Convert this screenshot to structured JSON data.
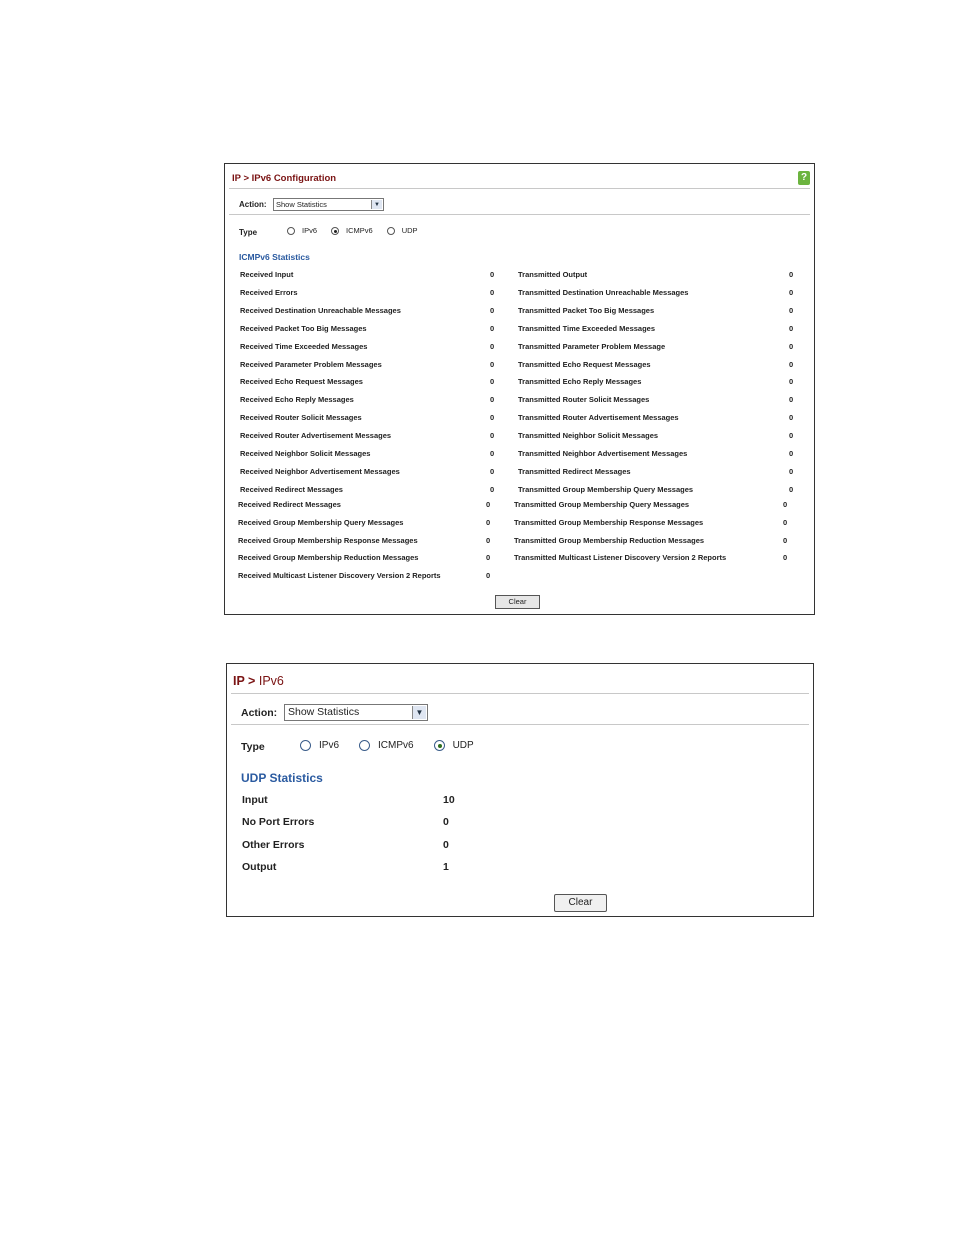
{
  "panel_icmp": {
    "title": "IP > IPv6 Configuration",
    "help_icon": "question-mark-icon",
    "action_label": "Action:",
    "action_value": "Show Statistics",
    "type_label": "Type",
    "radios": [
      {
        "label": "IPv6",
        "checked": false
      },
      {
        "label": "ICMPv6",
        "checked": true
      },
      {
        "label": "UDP",
        "checked": false
      }
    ],
    "section_title": "ICMPv6 Statistics",
    "left_stats": [
      {
        "label": "Received Input",
        "value": "0"
      },
      {
        "label": "Received Errors",
        "value": "0"
      },
      {
        "label": "Received Destination Unreachable Messages",
        "value": "0"
      },
      {
        "label": "Received Packet Too Big Messages",
        "value": "0"
      },
      {
        "label": "Received Time Exceeded Messages",
        "value": "0"
      },
      {
        "label": "Received Parameter Problem Messages",
        "value": "0"
      },
      {
        "label": "Received Echo Request Messages",
        "value": "0"
      },
      {
        "label": "Received Echo Reply Messages",
        "value": "0"
      },
      {
        "label": "Received Router Solicit Messages",
        "value": "0"
      },
      {
        "label": "Received Router Advertisement Messages",
        "value": "0"
      },
      {
        "label": "Received Neighbor Solicit Messages",
        "value": "0"
      },
      {
        "label": "Received Neighbor Advertisement Messages",
        "value": "0"
      },
      {
        "label": "Received Redirect Messages",
        "value": "0"
      }
    ],
    "right_stats": [
      {
        "label": "Transmitted Output",
        "value": "0"
      },
      {
        "label": "Transmitted Destination Unreachable Messages",
        "value": "0"
      },
      {
        "label": "Transmitted Packet Too Big Messages",
        "value": "0"
      },
      {
        "label": "Transmitted Time Exceeded Messages",
        "value": "0"
      },
      {
        "label": "Transmitted Parameter Problem Message",
        "value": "0"
      },
      {
        "label": "Transmitted Echo Request Messages",
        "value": "0"
      },
      {
        "label": "Transmitted Echo Reply Messages",
        "value": "0"
      },
      {
        "label": "Transmitted Router Solicit Messages",
        "value": "0"
      },
      {
        "label": "Transmitted Router Advertisement Messages",
        "value": "0"
      },
      {
        "label": "Transmitted Neighbor Solicit Messages",
        "value": "0"
      },
      {
        "label": "Transmitted Neighbor Advertisement Messages",
        "value": "0"
      },
      {
        "label": "Transmitted Redirect Messages",
        "value": "0"
      },
      {
        "label": "Transmitted Group Membership Query Messages",
        "value": "0"
      }
    ],
    "left_stats_ext": [
      {
        "label": "Received Redirect Messages",
        "value": "0"
      },
      {
        "label": "Received Group Membership Query Messages",
        "value": "0"
      },
      {
        "label": "Received Group Membership Response Messages",
        "value": "0"
      },
      {
        "label": "Received Group Membership Reduction Messages",
        "value": "0"
      },
      {
        "label": "Received Multicast Listener Discovery Version 2 Reports",
        "value": "0"
      }
    ],
    "right_stats_ext": [
      {
        "label": "Transmitted Group Membership Query Messages",
        "value": "0"
      },
      {
        "label": "Transmitted Group Membership Response Messages",
        "value": "0"
      },
      {
        "label": "Transmitted Group Membership Reduction Messages",
        "value": "0"
      },
      {
        "label": "Transmitted Multicast Listener Discovery Version 2 Reports",
        "value": "0"
      }
    ],
    "clear_label": "Clear"
  },
  "panel_udp": {
    "title_prefix": "IP > ",
    "title_main": "IPv6",
    "action_label": "Action:",
    "action_value": "Show Statistics",
    "type_label": "Type",
    "radios": [
      {
        "label": "IPv6",
        "checked": false
      },
      {
        "label": "ICMPv6",
        "checked": false
      },
      {
        "label": "UDP",
        "checked": true
      }
    ],
    "section_title": "UDP Statistics",
    "stats": [
      {
        "label": "Input",
        "value": "10"
      },
      {
        "label": "No Port Errors",
        "value": "0"
      },
      {
        "label": "Other Errors",
        "value": "0"
      },
      {
        "label": "Output",
        "value": "1"
      }
    ],
    "clear_label": "Clear"
  }
}
